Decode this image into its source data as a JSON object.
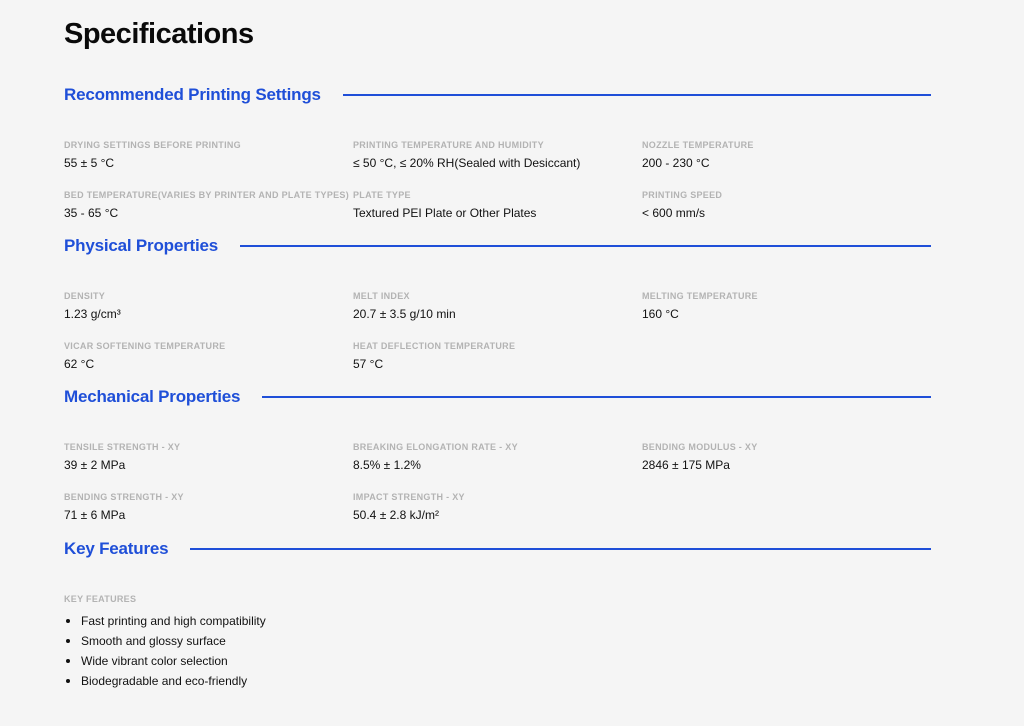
{
  "page": {
    "title": "Specifications"
  },
  "sections": [
    {
      "title": "Recommended Printing Settings",
      "rows": [
        [
          {
            "label": "DRYING SETTINGS BEFORE PRINTING",
            "value": "55 ± 5 °C"
          },
          {
            "label": "PRINTING TEMPERATURE AND HUMIDITY",
            "value": "≤ 50 °C, ≤ 20% RH(Sealed with Desiccant)"
          },
          {
            "label": "NOZZLE TEMPERATURE",
            "value": "200 - 230 °C"
          }
        ],
        [
          {
            "label": "BED TEMPERATURE(VARIES BY PRINTER AND PLATE TYPES)",
            "value": "35 - 65 °C"
          },
          {
            "label": "PLATE TYPE",
            "value": "Textured PEI Plate or Other Plates"
          },
          {
            "label": "PRINTING SPEED",
            "value": "< 600 mm/s"
          }
        ]
      ]
    },
    {
      "title": "Physical Properties",
      "rows": [
        [
          {
            "label": "DENSITY",
            "value": "1.23 g/cm³"
          },
          {
            "label": "MELT INDEX",
            "value": "20.7 ± 3.5 g/10 min"
          },
          {
            "label": "MELTING TEMPERATURE",
            "value": "160 °C"
          }
        ],
        [
          {
            "label": "VICAR SOFTENING TEMPERATURE",
            "value": "62 °C"
          },
          {
            "label": "HEAT DEFLECTION TEMPERATURE",
            "value": "57 °C"
          }
        ]
      ]
    },
    {
      "title": "Mechanical Properties",
      "rows": [
        [
          {
            "label": "TENSILE STRENGTH - XY",
            "value": "39 ± 2 MPa"
          },
          {
            "label": "BREAKING ELONGATION RATE - XY",
            "value": "8.5% ± 1.2%"
          },
          {
            "label": "BENDING MODULUS - XY",
            "value": "2846 ± 175 MPa"
          }
        ],
        [
          {
            "label": "BENDING STRENGTH - XY",
            "value": "71 ± 6 MPa"
          },
          {
            "label": "IMPACT STRENGTH - XY",
            "value": "50.4 ± 2.8 kJ/m²"
          }
        ]
      ]
    }
  ],
  "key_features": {
    "title": "Key Features",
    "label": "KEY FEATURES",
    "items": [
      "Fast printing and high compatibility",
      "Smooth and glossy surface",
      "Wide vibrant color selection",
      "Biodegradable and eco-friendly"
    ]
  },
  "colors": {
    "accent": "#1f4fd8",
    "background": "#f5f5f5",
    "label": "#b3b3b3",
    "text": "#111111"
  }
}
